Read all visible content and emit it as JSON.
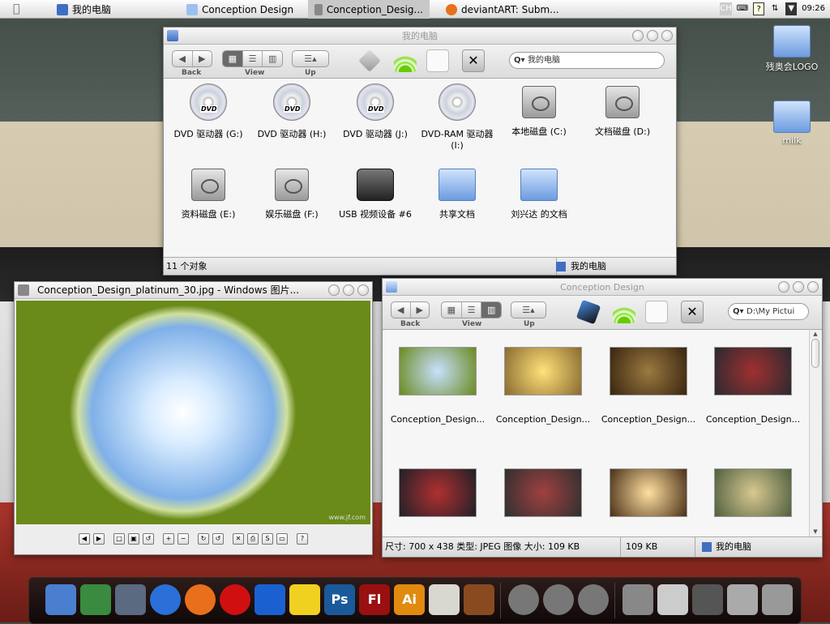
{
  "menubar": {
    "tasks": [
      {
        "label": "我的电脑"
      },
      {
        "label": "Conception Design"
      },
      {
        "label": "Conception_Desig...",
        "active": true
      },
      {
        "label": "deviantART: Subm..."
      }
    ],
    "tray": {
      "lang": "CH",
      "help": "?",
      "clock": "09:26"
    }
  },
  "desktop": {
    "icons": [
      {
        "label": "残奥会LOGO"
      },
      {
        "label": "milk"
      }
    ]
  },
  "mycomputer": {
    "title": "我的电脑",
    "toolbar": {
      "back": "Back",
      "view": "View",
      "up": "Up",
      "search_placeholder": "我的电脑"
    },
    "items": [
      {
        "label": "DVD 驱动器 (G:)",
        "type": "dvd"
      },
      {
        "label": "DVD 驱动器 (H:)",
        "type": "dvd"
      },
      {
        "label": "DVD 驱动器 (J:)",
        "type": "dvd"
      },
      {
        "label": "DVD-RAM 驱动器 (I:)",
        "type": "disc"
      },
      {
        "label": "本地磁盘 (C:)",
        "type": "hdd"
      },
      {
        "label": "文档磁盘 (D:)",
        "type": "hdd"
      },
      {
        "label": "资料磁盘 (E:)",
        "type": "hdd"
      },
      {
        "label": "娱乐磁盘 (F:)",
        "type": "hdd"
      },
      {
        "label": "USB 视频设备 #6",
        "type": "camera"
      },
      {
        "label": "共享文档",
        "type": "folder"
      },
      {
        "label": "刘兴达 的文档",
        "type": "folder"
      }
    ],
    "status": {
      "count": "11 个对象",
      "location": "我的电脑"
    }
  },
  "viewer": {
    "title": "Conception_Design_platinum_30.jpg - Windows 图片...",
    "watermark": "www.jf.com"
  },
  "conception": {
    "title": "Conception Design",
    "toolbar": {
      "back": "Back",
      "view": "View",
      "up": "Up",
      "search_value": "D:\\My Pictui"
    },
    "thumbs": [
      {
        "label": "Conception_Design...",
        "c1": "#c8e0ff",
        "c2": "#6a8a20"
      },
      {
        "label": "Conception_Design...",
        "c1": "#ffe27a",
        "c2": "#8a6a30"
      },
      {
        "label": "Conception_Design...",
        "c1": "#9a7a40",
        "c2": "#3a2510"
      },
      {
        "label": "Conception_Design...",
        "c1": "#a03030",
        "c2": "#2a2a30"
      },
      {
        "label": "",
        "c1": "#b03030",
        "c2": "#202028"
      },
      {
        "label": "",
        "c1": "#a04040",
        "c2": "#303030"
      },
      {
        "label": "",
        "c1": "#ffe0a0",
        "c2": "#4a3018"
      },
      {
        "label": "",
        "c1": "#d8c890",
        "c2": "#506040"
      }
    ],
    "status": {
      "info": "尺寸: 700 x 438 类型: JPEG 图像 大小: 109 KB",
      "size": "109 KB",
      "location": "我的电脑"
    }
  },
  "dock": {
    "items": [
      {
        "name": "finder",
        "color": "#4a7fd0"
      },
      {
        "name": "activity",
        "color": "#3a8a40"
      },
      {
        "name": "photos",
        "color": "#5a6a80"
      },
      {
        "name": "network",
        "color": "#2a70d8"
      },
      {
        "name": "firefox",
        "color": "#e8701a"
      },
      {
        "name": "record",
        "color": "#d01010"
      },
      {
        "name": "ie",
        "color": "#1a60d0"
      },
      {
        "name": "qq",
        "color": "#f0d020"
      },
      {
        "name": "photoshop",
        "label": "Ps",
        "color": "#1a5a9a"
      },
      {
        "name": "flash",
        "label": "Fl",
        "color": "#9a1010"
      },
      {
        "name": "illustrator",
        "label": "Ai",
        "color": "#e08a10"
      },
      {
        "name": "textedit",
        "color": "#d8d8d0"
      },
      {
        "name": "guitar",
        "color": "#8a4a20"
      },
      {
        "name": "power",
        "color": "#777"
      },
      {
        "name": "back",
        "color": "#777"
      },
      {
        "name": "home",
        "color": "#777"
      },
      {
        "name": "drive",
        "color": "#888"
      },
      {
        "name": "apple-logo",
        "color": "#ccc"
      },
      {
        "name": "downloads",
        "color": "#555"
      },
      {
        "name": "mail",
        "color": "#aaa"
      },
      {
        "name": "trash",
        "color": "#999"
      }
    ]
  }
}
